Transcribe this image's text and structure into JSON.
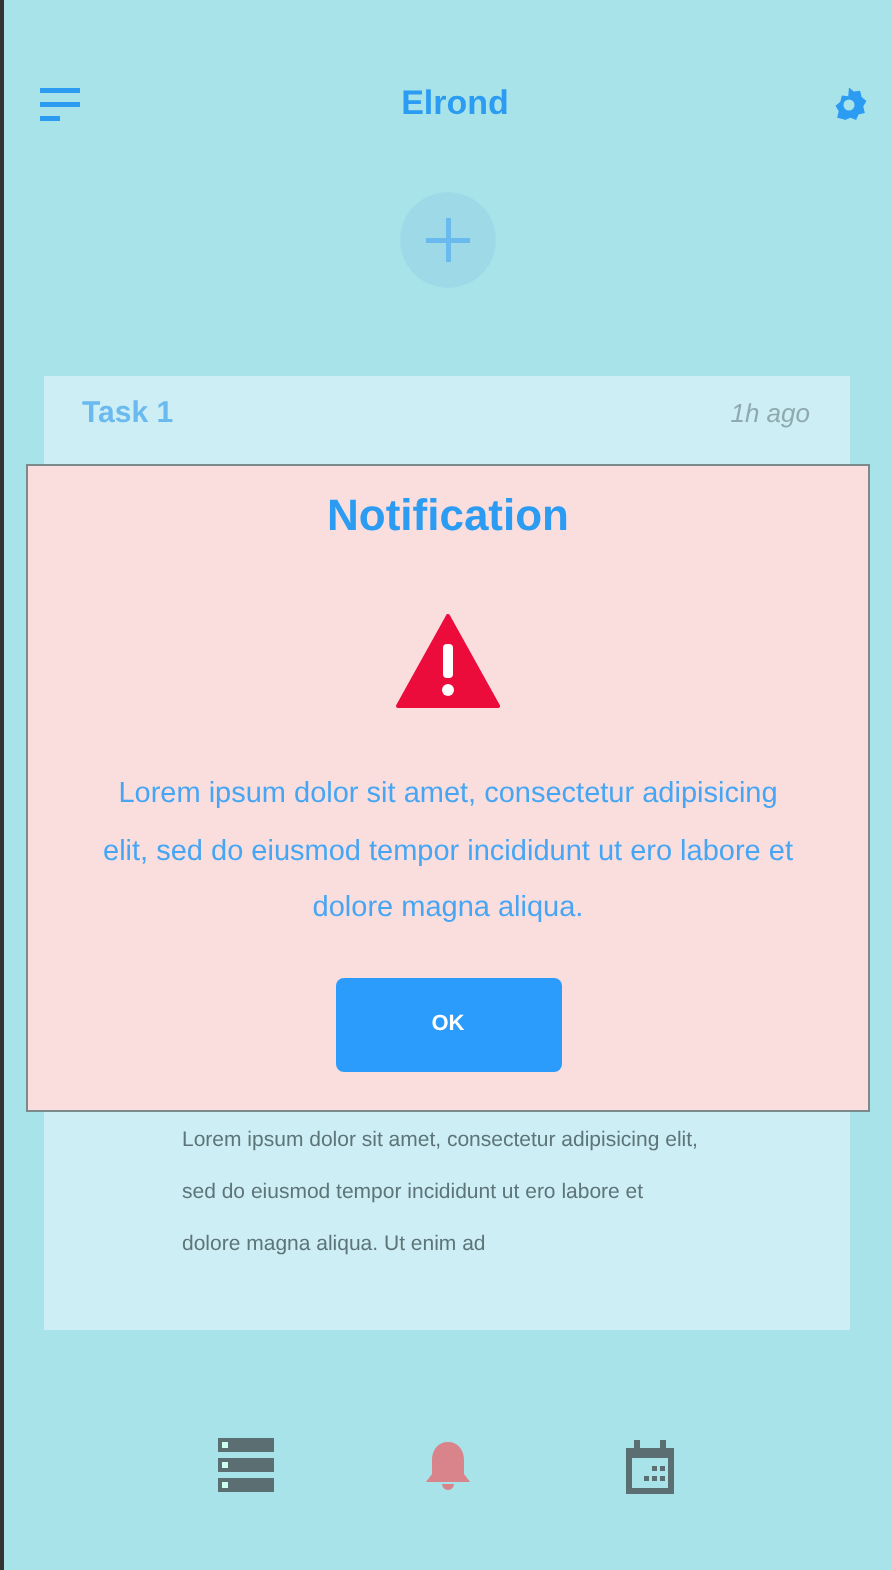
{
  "header": {
    "title": "Elrond"
  },
  "task": {
    "title": "Task 1",
    "time": "1h ago",
    "body": "Lorem ipsum dolor sit amet, consectetur adipisicing elit, sed do eiusmod tempor incididunt ut ero labore et dolore magna aliqua. Ut enim ad"
  },
  "dialog": {
    "title": "Notification",
    "message": "Lorem ipsum dolor sit amet, consectetur adipisicing elit, sed do eiusmod tempor incididunt ut ero labore et dolore magna aliqua.",
    "button": "OK"
  },
  "nav": [
    {
      "kind": "list",
      "selected": false
    },
    {
      "kind": "bell",
      "selected": true
    },
    {
      "kind": "calendar",
      "selected": false
    }
  ]
}
